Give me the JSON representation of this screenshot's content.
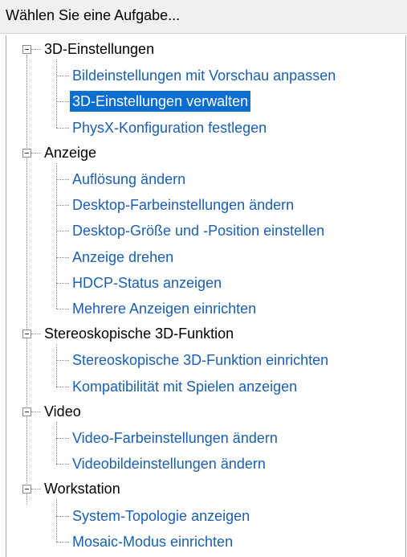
{
  "header": {
    "title": "Wählen Sie eine Aufgabe..."
  },
  "tree": [
    {
      "label": "3D-Einstellungen",
      "items": [
        {
          "label": "Bildeinstellungen mit Vorschau anpassen"
        },
        {
          "label": "3D-Einstellungen verwalten",
          "selected": true
        },
        {
          "label": "PhysX-Konfiguration festlegen"
        }
      ]
    },
    {
      "label": "Anzeige",
      "items": [
        {
          "label": "Auflösung ändern"
        },
        {
          "label": "Desktop-Farbeinstellungen ändern"
        },
        {
          "label": "Desktop-Größe und -Position einstellen"
        },
        {
          "label": "Anzeige drehen"
        },
        {
          "label": "HDCP-Status anzeigen"
        },
        {
          "label": "Mehrere Anzeigen einrichten"
        }
      ]
    },
    {
      "label": "Stereoskopische 3D-Funktion",
      "items": [
        {
          "label": "Stereoskopische 3D-Funktion einrichten"
        },
        {
          "label": "Kompatibilität mit Spielen anzeigen"
        }
      ]
    },
    {
      "label": "Video",
      "items": [
        {
          "label": "Video-Farbeinstellungen ändern"
        },
        {
          "label": "Videobildeinstellungen ändern"
        }
      ]
    },
    {
      "label": "Workstation",
      "items": [
        {
          "label": "System-Topologie anzeigen"
        },
        {
          "label": "Mosaic-Modus einrichten"
        }
      ]
    }
  ]
}
